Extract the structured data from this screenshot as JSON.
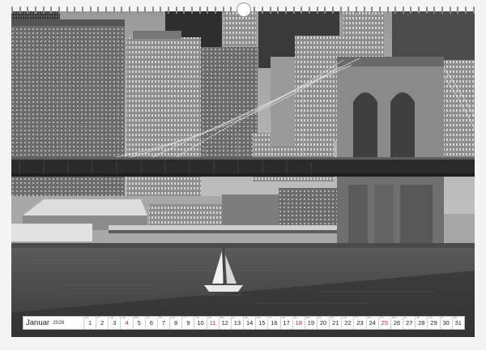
{
  "calendar": {
    "month": "Januar",
    "year": "2026",
    "sunday_color": "#c2252e",
    "days": [
      {
        "num": "1",
        "wd": "Do",
        "sunday": false
      },
      {
        "num": "2",
        "wd": "Fr",
        "sunday": false
      },
      {
        "num": "3",
        "wd": "Sa",
        "sunday": false
      },
      {
        "num": "4",
        "wd": "So",
        "sunday": true
      },
      {
        "num": "5",
        "wd": "Mo",
        "sunday": false
      },
      {
        "num": "6",
        "wd": "Di",
        "sunday": false
      },
      {
        "num": "7",
        "wd": "Mi",
        "sunday": false
      },
      {
        "num": "8",
        "wd": "Do",
        "sunday": false
      },
      {
        "num": "9",
        "wd": "Fr",
        "sunday": false
      },
      {
        "num": "10",
        "wd": "Sa",
        "sunday": false
      },
      {
        "num": "11",
        "wd": "So",
        "sunday": true
      },
      {
        "num": "12",
        "wd": "Mo",
        "sunday": false
      },
      {
        "num": "13",
        "wd": "Di",
        "sunday": false
      },
      {
        "num": "14",
        "wd": "Mi",
        "sunday": false
      },
      {
        "num": "15",
        "wd": "Do",
        "sunday": false
      },
      {
        "num": "16",
        "wd": "Fr",
        "sunday": false
      },
      {
        "num": "17",
        "wd": "Sa",
        "sunday": false
      },
      {
        "num": "18",
        "wd": "So",
        "sunday": true
      },
      {
        "num": "19",
        "wd": "Mo",
        "sunday": false
      },
      {
        "num": "20",
        "wd": "Di",
        "sunday": false
      },
      {
        "num": "21",
        "wd": "Mi",
        "sunday": false
      },
      {
        "num": "22",
        "wd": "Do",
        "sunday": false
      },
      {
        "num": "23",
        "wd": "Fr",
        "sunday": false
      },
      {
        "num": "24",
        "wd": "Sa",
        "sunday": false
      },
      {
        "num": "25",
        "wd": "So",
        "sunday": true
      },
      {
        "num": "26",
        "wd": "Mo",
        "sunday": false
      },
      {
        "num": "27",
        "wd": "Di",
        "sunday": false
      },
      {
        "num": "28",
        "wd": "Mi",
        "sunday": false
      },
      {
        "num": "29",
        "wd": "Do",
        "sunday": false
      },
      {
        "num": "30",
        "wd": "Fr",
        "sunday": false
      },
      {
        "num": "31",
        "wd": "Sa",
        "sunday": false
      }
    ]
  },
  "photo": {
    "subject": "Brooklyn Bridge and Lower Manhattan skyline",
    "style": "black-and-white with sailboat"
  }
}
